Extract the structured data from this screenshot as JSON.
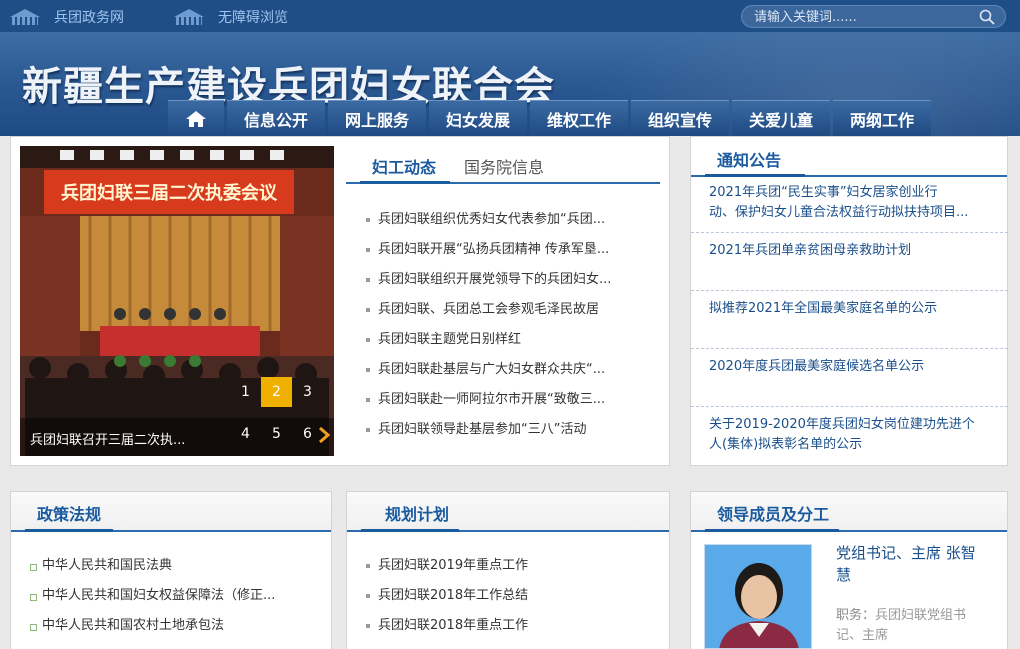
{
  "topbar": {
    "links": [
      "兵团政务网",
      "无障碍浏览"
    ],
    "search_placeholder": "请输入关键词......"
  },
  "header": {
    "site_title": "新疆生产建设兵团妇女联合会",
    "nav": [
      "信息公开",
      "网上服务",
      "妇女发展",
      "维权工作",
      "组织宣传",
      "关爱儿童",
      "两纲工作"
    ]
  },
  "slideshow": {
    "caption": "兵团妇联召开三届二次执...",
    "banner_text": "兵团妇联三届二次执委会议",
    "pages": [
      "1",
      "2",
      "3",
      "4",
      "5",
      "6"
    ],
    "active_page": "2"
  },
  "news": {
    "tabs": [
      "妇工动态",
      "国务院信息"
    ],
    "items": [
      "兵团妇联组织优秀妇女代表参加“兵团...",
      "兵团妇联开展“弘扬兵团精神 传承军垦...",
      "兵团妇联组织开展党领导下的兵团妇女...",
      "兵团妇联、兵团总工会参观毛泽民故居",
      "兵团妇联主题党日别样红",
      "兵团妇联赴基层与广大妇女群众共庆“...",
      "兵团妇联赴一师阿拉尔市开展“致敬三...",
      "兵团妇联领导赴基层参加“三八”活动"
    ]
  },
  "notice": {
    "title": "通知公告",
    "items": [
      [
        "2021年兵团“民生实事”妇女居家创业行",
        "动、保护妇女儿童合法权益行动拟扶持项目..."
      ],
      [
        "2021年兵团单亲贫困母亲救助计划"
      ],
      [
        "拟推荐2021年全国最美家庭名单的公示"
      ],
      [
        "2020年度兵团最美家庭候选名单公示"
      ],
      [
        "关于2019-2020年度兵团妇女岗位建功先进个",
        "人(集体)拟表彰名单的公示"
      ]
    ]
  },
  "policy": {
    "title": "政策法规",
    "items": [
      "中华人民共和国民法典",
      "中华人民共和国妇女权益保障法（修正...",
      "中华人民共和国农村土地承包法"
    ]
  },
  "plan": {
    "title": "规划计划",
    "items": [
      "兵团妇联2019年重点工作",
      "兵团妇联2018年工作总结",
      "兵团妇联2018年重点工作"
    ]
  },
  "leaders": {
    "title": "领导成员及分工",
    "name_lines": [
      "党组书记、主席 张智",
      "慧"
    ],
    "duty_label": "职务：",
    "duty_lines": [
      "兵团妇联党组书",
      "记、主席"
    ]
  },
  "colors": {
    "primary": "#1a5a9f",
    "nav_bg": "#1f4a82",
    "accent": "#f0b000"
  }
}
